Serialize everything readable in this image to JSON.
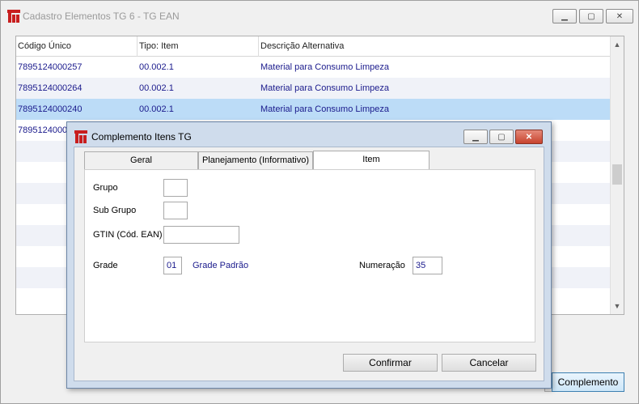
{
  "window": {
    "title": "Cadastro Elementos TG 6 - TG EAN",
    "minimize_glyph": "▁",
    "maximize_glyph": "▢",
    "close_glyph": "✕"
  },
  "grid": {
    "columns": [
      "Código Único",
      "Tipo: Item",
      "Descrição Alternativa"
    ],
    "rows": [
      {
        "codigo": "7895124000257",
        "tipo": "00.002.1",
        "descricao": "Material para Consumo Limpeza"
      },
      {
        "codigo": "7895124000264",
        "tipo": "00.002.1",
        "descricao": "Material para Consumo Limpeza"
      },
      {
        "codigo": "7895124000240",
        "tipo": "00.002.1",
        "descricao": "Material para Consumo Limpeza"
      },
      {
        "codigo": "7895124000",
        "tipo": "",
        "descricao": ""
      }
    ],
    "scroll_up_glyph": "▲",
    "scroll_down_glyph": "▼"
  },
  "main_buttons": {
    "complemento": "Complemento"
  },
  "dialog": {
    "title": "Complemento Itens TG",
    "tabs": [
      "Geral",
      "Planejamento (Informativo)",
      "Item"
    ],
    "active_tab": "Item",
    "fields": {
      "grupo_label": "Grupo",
      "grupo_value": "",
      "subgrupo_label": "Sub Grupo",
      "subgrupo_value": "",
      "gtin_label": "GTIN (Cód. EAN)",
      "gtin_value": "",
      "grade_label": "Grade",
      "grade_value": "01",
      "grade_desc": "Grade Padrão",
      "numeracao_label": "Numeração",
      "numeracao_value": "35"
    },
    "buttons": {
      "confirmar": "Confirmar",
      "cancelar": "Cancelar"
    }
  },
  "colors": {
    "accent": "#c81e1e",
    "selection": "#bcdcf7",
    "link_text": "#1a1a8c",
    "dialog_frame": "#cfdcec"
  }
}
